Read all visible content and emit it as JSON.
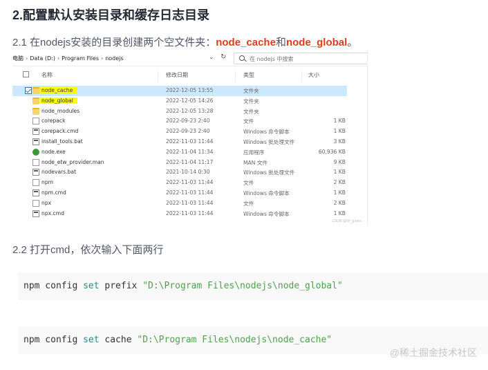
{
  "heading": "2.配置默认安装目录和缓存日志目录",
  "step1": {
    "prefix": "2.1 在nodejs安装的目录创建两个空文件夹：",
    "folder_a": "node_cache",
    "joiner": "和",
    "folder_b": "node_global",
    "suffix": "。"
  },
  "explorer": {
    "breadcrumbs": [
      "电脑",
      "Data (D:)",
      "Program Files",
      "nodejs"
    ],
    "search_placeholder": "在 nodejs 中搜索",
    "columns": {
      "name": "名称",
      "date": "修改日期",
      "type": "类型",
      "size": "大小"
    },
    "rows": [
      {
        "name": "node_cache",
        "date": "2022-12-05 13:55",
        "type": "文件夹",
        "size": "",
        "icon": "folder-icon",
        "selected": true,
        "highlight": true
      },
      {
        "name": "node_global",
        "date": "2022-12-05 14:26",
        "type": "文件夹",
        "size": "",
        "icon": "folder-icon",
        "highlight": true
      },
      {
        "name": "node_modules",
        "date": "2022-12-05 13:28",
        "type": "文件夹",
        "size": "",
        "icon": "folder-icon"
      },
      {
        "name": "corepack",
        "date": "2022-09-23 2:40",
        "type": "文件",
        "size": "1 KB",
        "icon": "file-icon"
      },
      {
        "name": "corepack.cmd",
        "date": "2022-09-23 2:40",
        "type": "Windows 命令脚本",
        "size": "1 KB",
        "icon": "cmd-icon"
      },
      {
        "name": "install_tools.bat",
        "date": "2022-11-03 11:44",
        "type": "Windows 批处理文件",
        "size": "3 KB",
        "icon": "cmd-icon"
      },
      {
        "name": "node.exe",
        "date": "2022-11-04 11:34",
        "type": "应用程序",
        "size": "60,936 KB",
        "icon": "node-exe-icon"
      },
      {
        "name": "node_etw_provider.man",
        "date": "2022-11-04 11:17",
        "type": "MAN 文件",
        "size": "9 KB",
        "icon": "file-icon"
      },
      {
        "name": "nodevars.bat",
        "date": "2021-10-14 0:30",
        "type": "Windows 批处理文件",
        "size": "1 KB",
        "icon": "cmd-icon"
      },
      {
        "name": "npm",
        "date": "2022-11-03 11:44",
        "type": "文件",
        "size": "2 KB",
        "icon": "file-icon"
      },
      {
        "name": "npm.cmd",
        "date": "2022-11-03 11:44",
        "type": "Windows 命令脚本",
        "size": "1 KB",
        "icon": "cmd-icon"
      },
      {
        "name": "npx",
        "date": "2022-11-03 11:44",
        "type": "文件",
        "size": "2 KB",
        "icon": "file-icon"
      },
      {
        "name": "npx.cmd",
        "date": "2022-11-03 11:44",
        "type": "Windows 命令脚本",
        "size": "1 KB",
        "icon": "cmd-icon"
      }
    ],
    "watermark": "CSDN @lili_given"
  },
  "step2": "2.2 打开cmd，依次输入下面两行",
  "code": [
    {
      "cmd": "npm config ",
      "kw": "set",
      "arg": " prefix ",
      "str": "\"D:\\Program Files\\nodejs\\node_global\""
    },
    {
      "cmd": "npm config ",
      "kw": "set",
      "arg": " cache ",
      "str": "\"D:\\Program Files\\nodejs\\node_cache\""
    }
  ],
  "watermark": "@稀土掘金技术社区",
  "colors": {
    "highlight_text": "#e03a1d",
    "selection": "#cce8ff",
    "marker": "#ffff00"
  }
}
